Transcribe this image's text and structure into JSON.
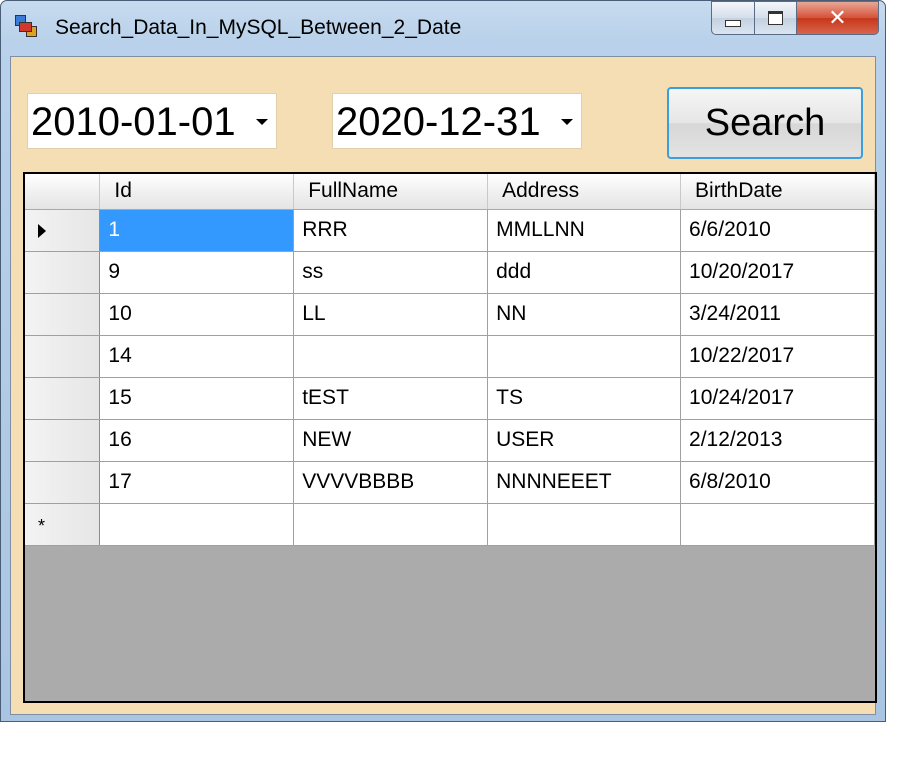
{
  "window": {
    "title": "Search_Data_In_MySQL_Between_2_Date"
  },
  "filters": {
    "from_date": "2010-01-01",
    "to_date": "2020-12-31",
    "search_label": "Search"
  },
  "grid": {
    "columns": [
      "Id",
      "FullName",
      "Address",
      "BirthDate"
    ],
    "rows": [
      [
        "1",
        "RRR",
        "MMLLNN",
        "6/6/2010"
      ],
      [
        "9",
        "ss",
        "ddd",
        "10/20/2017"
      ],
      [
        "10",
        "LL",
        "NN",
        "3/24/2011"
      ],
      [
        "14",
        "",
        "",
        "10/22/2017"
      ],
      [
        "15",
        "tEST",
        "TS",
        "10/24/2017"
      ],
      [
        "16",
        "NEW",
        "USER",
        "2/12/2013"
      ],
      [
        "17",
        "VVVVBBBB",
        "NNNNEEET",
        "6/8/2010"
      ]
    ],
    "new_row_marker": "*"
  },
  "colors": {
    "client_background": "#f5deb3",
    "grid_empty_area": "#ababab",
    "selection": "#3399ff",
    "search_focus_border": "#3c9fdc"
  }
}
